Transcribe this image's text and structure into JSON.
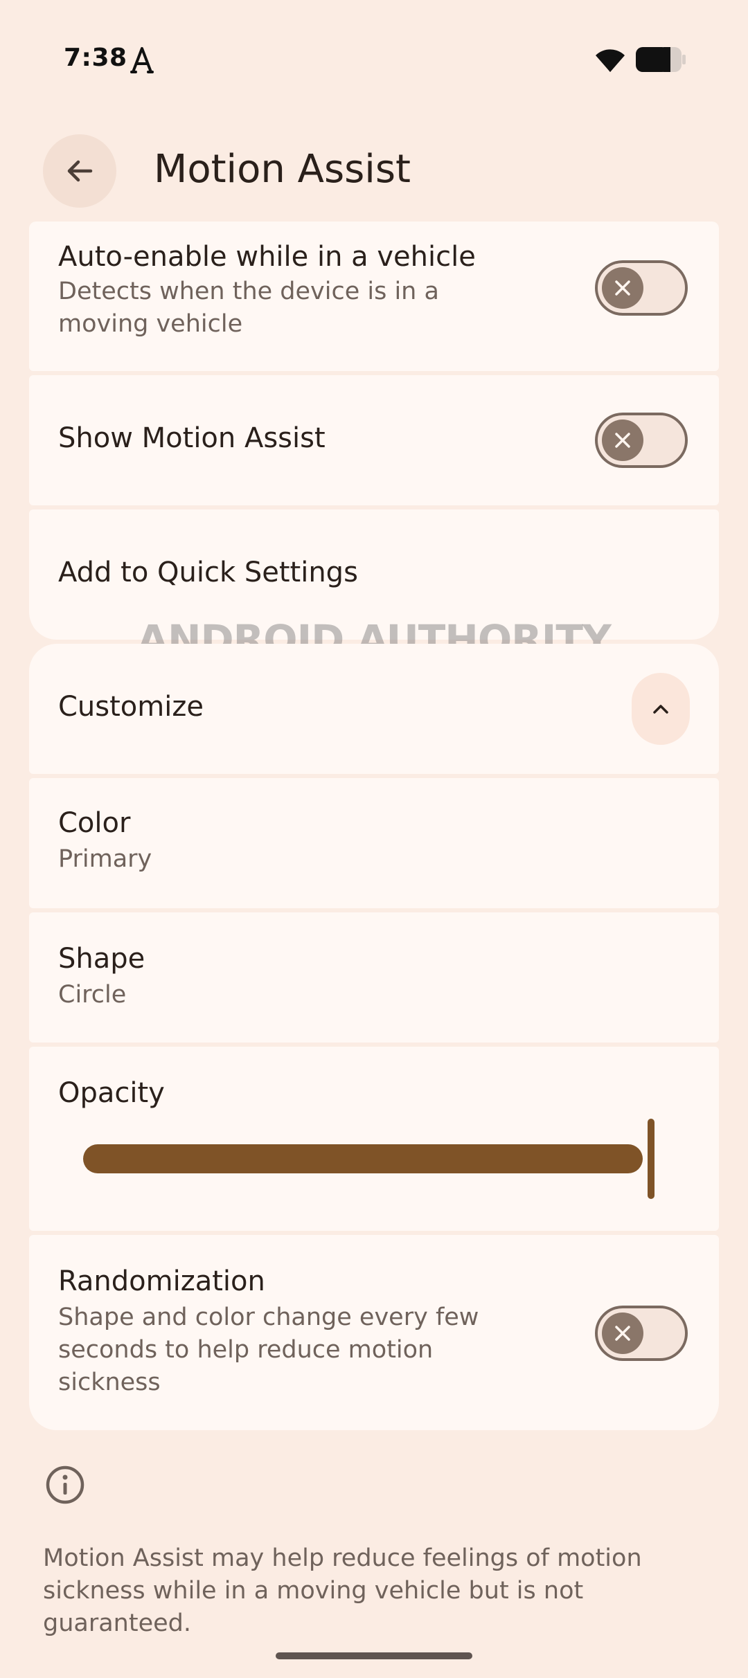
{
  "status_bar": {
    "time": "7:38",
    "icons": [
      "a-logo-icon",
      "wifi-icon",
      "battery-icon"
    ]
  },
  "header": {
    "title": "Motion Assist",
    "back_icon": "arrow-back-icon"
  },
  "settings": {
    "auto_enable": {
      "title": "Auto-enable while in a vehicle",
      "subtitle": "Detects when the device is in a moving vehicle",
      "enabled": false
    },
    "show_motion_assist": {
      "title": "Show Motion Assist",
      "enabled": false
    },
    "quick_settings": {
      "title": "Add to Quick Settings"
    },
    "customize": {
      "title": "Customize",
      "expanded": true,
      "icon": "chevron-up-icon"
    },
    "color": {
      "title": "Color",
      "value": "Primary"
    },
    "shape": {
      "title": "Shape",
      "value": "Circle"
    },
    "opacity": {
      "title": "Opacity",
      "level": 1.0
    },
    "randomization": {
      "title": "Randomization",
      "subtitle": "Shape and color change every few seconds to help reduce motion sickness",
      "enabled": false
    }
  },
  "footer": {
    "info_icon": "info-icon",
    "text": "Motion Assist may help reduce feelings of motion sickness while in a moving vehicle but is not guaranteed."
  },
  "watermark": "ANDROID AUTHORITY",
  "colors": {
    "background": "#fbece3",
    "card": "#fff8f4",
    "accent": "#7f5327"
  }
}
